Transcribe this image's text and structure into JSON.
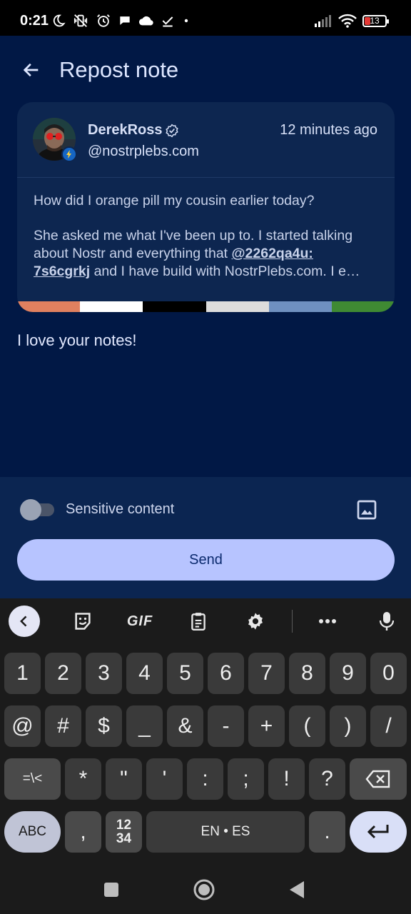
{
  "status_bar": {
    "time": "0:21",
    "battery": "13",
    "icons": [
      "moon-icon",
      "vibrate-off-icon",
      "alarm-icon",
      "chat-icon",
      "cloud-icon",
      "check-download-icon",
      "dot-icon",
      "signal-icon",
      "wifi-icon",
      "battery-icon"
    ],
    "battery_color": "#e53935"
  },
  "app_bar": {
    "title": "Repost note",
    "back_icon": "arrow-back-icon"
  },
  "note_card": {
    "author_name": "DerekRoss",
    "author_nip05": "@nostrplebs.com",
    "timestamp": "12 minutes ago",
    "body_line1": "How did I orange pill my cousin earlier today?",
    "body_line2": "She asked me what I've been up to. I started talking",
    "body_line3_pre": "about Nostr and everything that ",
    "mention_part1": "@2262qa4u:",
    "mention_part2": "7s6cgrkj",
    "body_line4_post": " and I have build with NostrPlebs.com. I e…",
    "strip_colors": [
      "#e0805f",
      "#ffffff",
      "#000000",
      "#dcdcdc",
      "#6f90c0",
      "#3f8a33"
    ]
  },
  "comment": {
    "text": "I love your notes!"
  },
  "bottom_panel": {
    "sensitive_label": "Sensitive content",
    "sensitive_enabled": false,
    "send_label": "Send",
    "image_icon": "image-icon",
    "accent": "#b7c4ff"
  },
  "keyboard": {
    "toolbar": [
      "chevron-left-icon",
      "sticker-icon",
      "GIF",
      "clipboard-icon",
      "gear-icon",
      "more-icon",
      "mic-icon"
    ],
    "gif_label": "GIF",
    "row1": [
      "1",
      "2",
      "3",
      "4",
      "5",
      "6",
      "7",
      "8",
      "9",
      "0"
    ],
    "row2": [
      "@",
      "#",
      "$",
      "_",
      "&",
      "-",
      "+",
      "(",
      ")",
      "/"
    ],
    "row3": [
      "=\\<",
      "*",
      "\"",
      "'",
      ":",
      ";",
      "!",
      "?"
    ],
    "abc_label": "ABC",
    "comma_label": ",",
    "numpad_top": "12",
    "numpad_bottom": "34",
    "space_label": "EN • ES",
    "period_label": "."
  },
  "nav_bar": {
    "buttons": [
      "recents-icon",
      "home-icon",
      "back-icon"
    ]
  }
}
